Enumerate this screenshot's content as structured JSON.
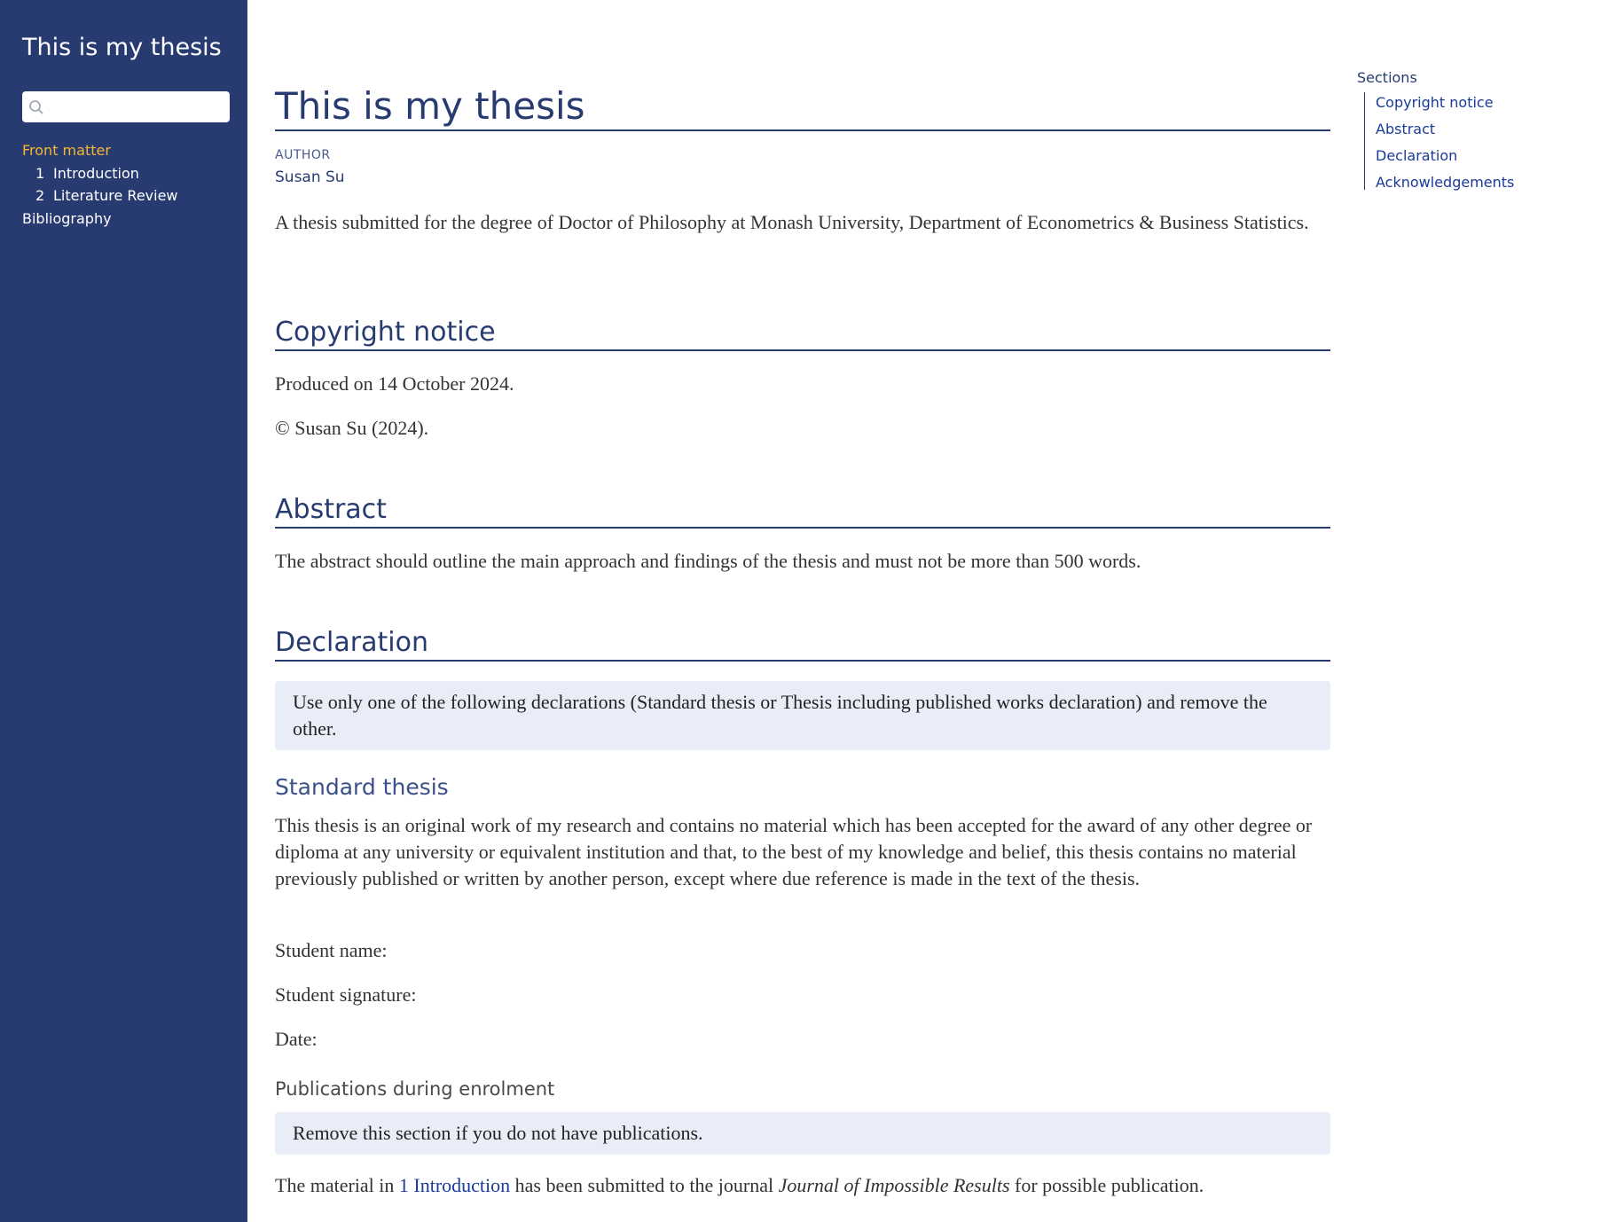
{
  "sidebar": {
    "title": "This is my thesis",
    "search": {
      "placeholder": ""
    },
    "items": [
      {
        "number": "",
        "label": "Front matter",
        "active": true
      },
      {
        "number": "1",
        "label": "Introduction",
        "active": false
      },
      {
        "number": "2",
        "label": "Literature Review",
        "active": false
      },
      {
        "number": "",
        "label": "Bibliography",
        "active": false
      }
    ]
  },
  "toc": {
    "title": "Sections",
    "items": [
      "Copyright notice",
      "Abstract",
      "Declaration",
      "Acknowledgements"
    ]
  },
  "main": {
    "title": "This is my thesis",
    "author_label": "AUTHOR",
    "author": "Susan Su",
    "intro": "A thesis submitted for the degree of Doctor of Philosophy at Monash University, Department of Econometrics & Business Statistics.",
    "copyright": {
      "heading": "Copyright notice",
      "produced": "Produced on 14 October 2024.",
      "notice": "© Susan Su (2024)."
    },
    "abstract": {
      "heading": "Abstract",
      "text": "The abstract should outline the main approach and findings of the thesis and must not be more than 500 words."
    },
    "declaration": {
      "heading": "Declaration",
      "callout": "Use only one of the following declarations (Standard thesis or Thesis including published works declaration) and remove the other.",
      "standard_heading": "Standard thesis",
      "standard_text": "This thesis is an original work of my research and contains no material which has been accepted for the award of any other degree or diploma at any university or equivalent institution and that, to the best of my knowledge and belief, this thesis contains no material previously published or written by another person, except where due reference is made in the text of the thesis.",
      "student_name": "Student name:",
      "student_signature": "Student signature:",
      "date": "Date:",
      "publications_heading": "Publications during enrolment",
      "publications_callout": "Remove this section if you do not have publications.",
      "material_prefix": "The material in ",
      "material_link": "1  Introduction",
      "material_middle": " has been submitted to the journal ",
      "material_journal": "Journal of Impossible Results",
      "material_suffix": " for possible publication."
    }
  }
}
